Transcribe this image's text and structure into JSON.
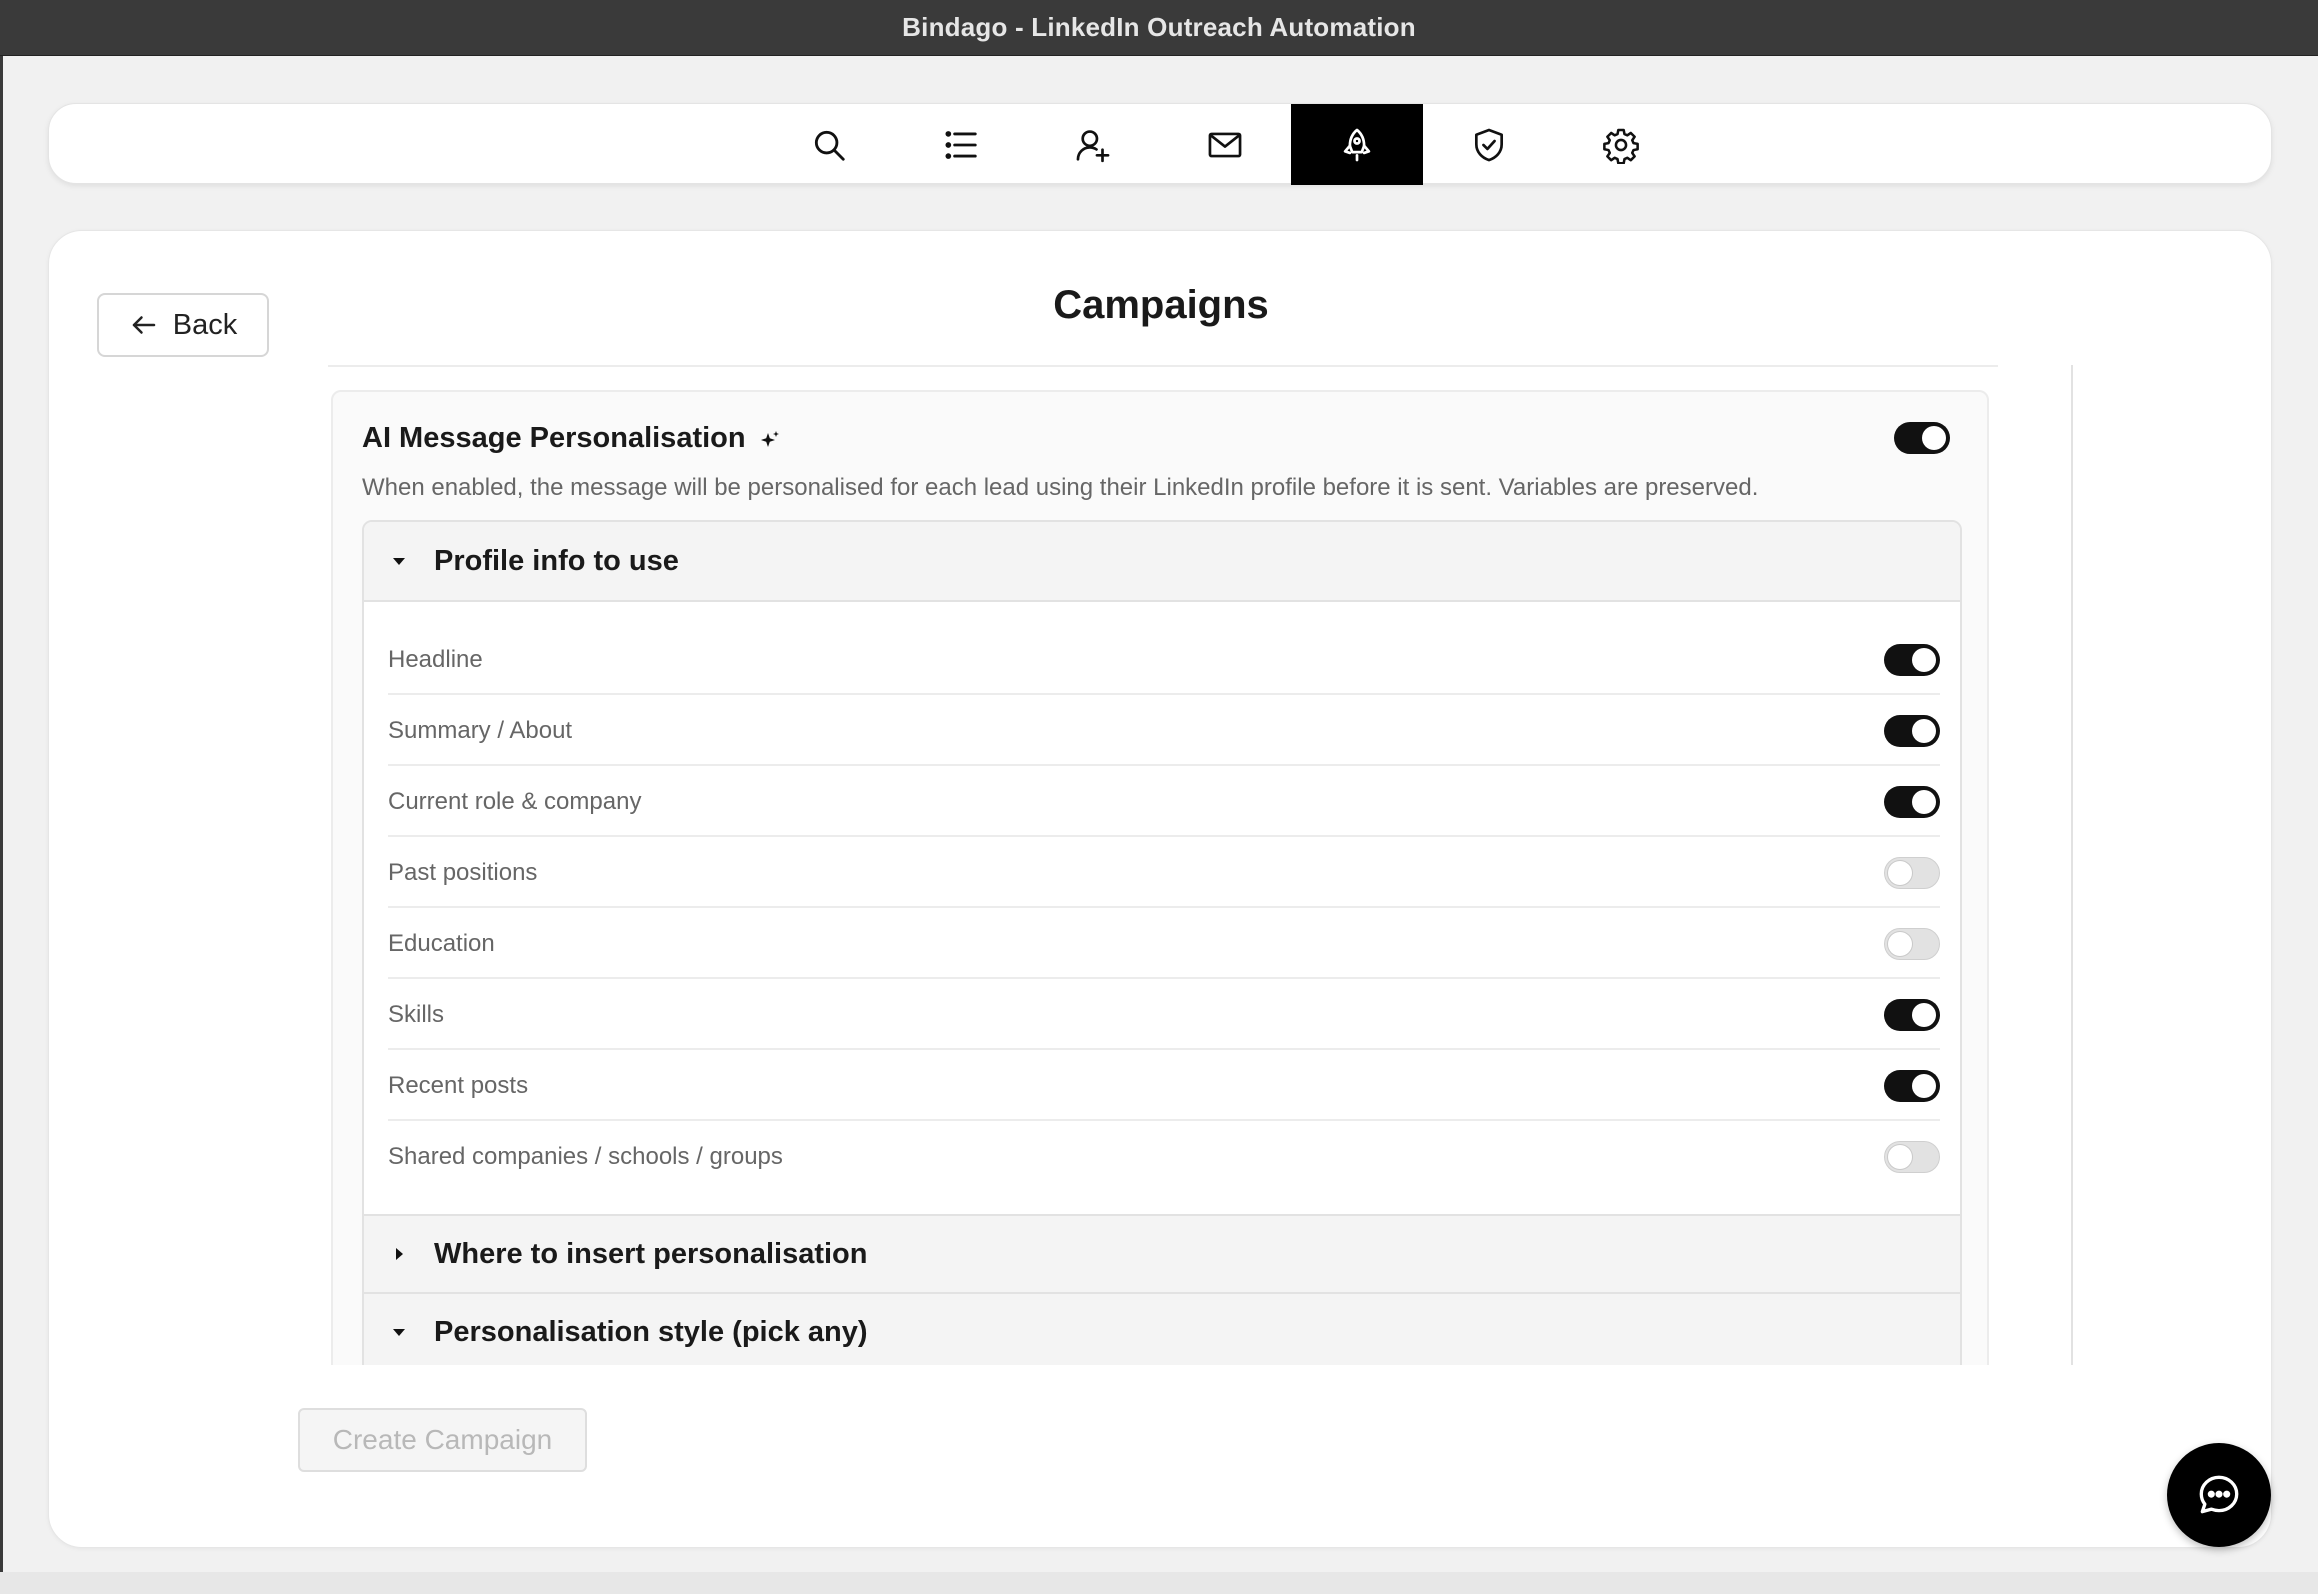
{
  "window": {
    "title": "Bindago - LinkedIn Outreach Automation"
  },
  "topnav": {
    "items": [
      {
        "icon": "search-icon",
        "active": false
      },
      {
        "icon": "list-icon",
        "active": false
      },
      {
        "icon": "user-add-icon",
        "active": false
      },
      {
        "icon": "mail-icon",
        "active": false
      },
      {
        "icon": "rocket-icon",
        "active": true
      },
      {
        "icon": "shield-check-icon",
        "active": false
      },
      {
        "icon": "gear-icon",
        "active": false
      }
    ]
  },
  "page": {
    "back_label": "Back",
    "title": "Campaigns"
  },
  "ai_personalisation": {
    "title": "AI Message Personalisation",
    "enabled": true,
    "description": "When enabled, the message will be personalised for each lead using their LinkedIn profile before it is sent. Variables are preserved.",
    "sections": {
      "profile_info": {
        "label": "Profile info to use",
        "expanded": true,
        "options": [
          {
            "label": "Headline",
            "enabled": true
          },
          {
            "label": "Summary / About",
            "enabled": true
          },
          {
            "label": "Current role & company",
            "enabled": true
          },
          {
            "label": "Past positions",
            "enabled": false
          },
          {
            "label": "Education",
            "enabled": false
          },
          {
            "label": "Skills",
            "enabled": true
          },
          {
            "label": "Recent posts",
            "enabled": true
          },
          {
            "label": "Shared companies / schools / groups",
            "enabled": false
          }
        ]
      },
      "where_to_insert": {
        "label": "Where to insert personalisation",
        "expanded": false
      },
      "style": {
        "label": "Personalisation style (pick any)",
        "expanded": true
      }
    }
  },
  "footer": {
    "create_label": "Create Campaign"
  },
  "colors": {
    "accent": "#000000",
    "toggle_on": "#111111",
    "toggle_off": "#e2e2e2",
    "muted_text": "#666666"
  }
}
